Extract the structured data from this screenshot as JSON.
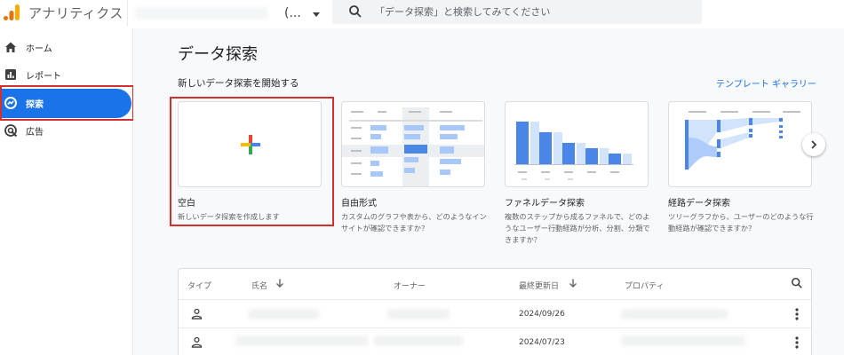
{
  "header": {
    "app_title": "アナリティクス",
    "account": "(...",
    "search_placeholder": "「データ探索」と検索してみてください"
  },
  "sidebar": {
    "items": [
      {
        "label": "ホーム",
        "icon": "home-icon",
        "active": false
      },
      {
        "label": "レポート",
        "icon": "reports-icon",
        "active": false
      },
      {
        "label": "探索",
        "icon": "explore-icon",
        "active": true
      },
      {
        "label": "広告",
        "icon": "advertising-icon",
        "active": false
      }
    ]
  },
  "main": {
    "title": "データ探索",
    "section_title": "新しいデータ探索を開始する",
    "template_link": "テンプレート ギャラリー",
    "cards": [
      {
        "title": "空白",
        "desc": "新しいデータ探索を作成します"
      },
      {
        "title": "自由形式",
        "desc": "カスタムのグラフや表から、どのようなインサイトが確認できますか？"
      },
      {
        "title": "ファネルデータ探索",
        "desc": "複数のステップから成るファネルで、どのようなユーザー行動経路が分析、分割、分類できますか？"
      },
      {
        "title": "経路データ探索",
        "desc": "ツリーグラフから、ユーザーのどのような行動経路が確認できますか？"
      }
    ]
  },
  "table": {
    "columns": {
      "type": "タイプ",
      "name": "氏名",
      "owner": "オーナー",
      "last_modified": "最終更新日",
      "property": "プロパティ"
    },
    "rows": [
      {
        "last_modified": "2024/09/26"
      },
      {
        "last_modified": "2024/07/23"
      }
    ]
  },
  "colors": {
    "accent": "#1a73e8",
    "highlight_border": "#d32f2f",
    "logo_orange": "#f9ab00",
    "logo_dark_orange": "#e37400"
  }
}
